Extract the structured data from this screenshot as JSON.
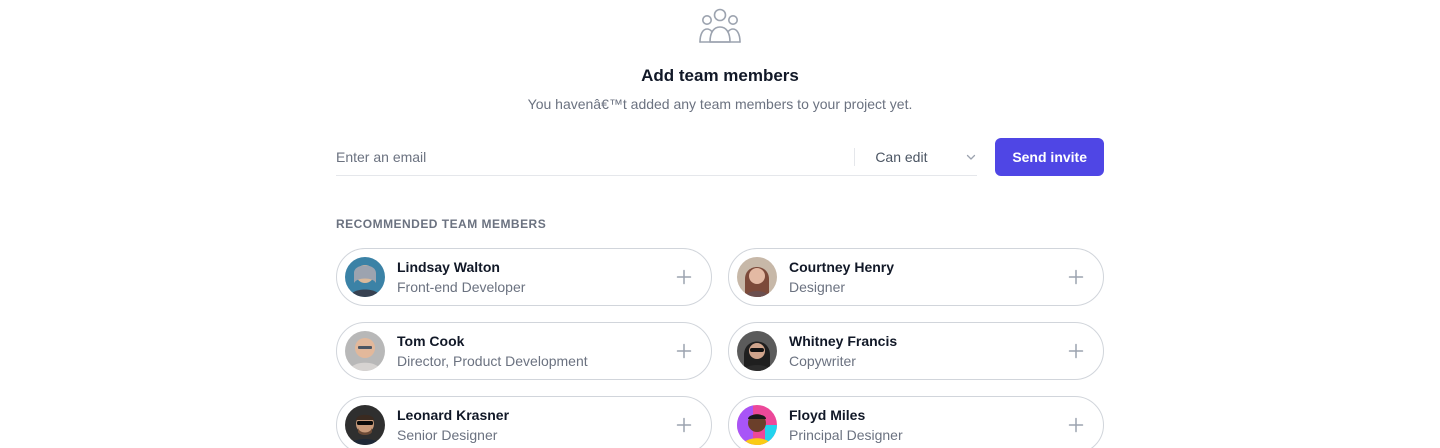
{
  "header": {
    "title": "Add team members",
    "subtitle": "You havenâ€™t added any team members to your project yet."
  },
  "invite": {
    "email_placeholder": "Enter an email",
    "permission": "Can edit",
    "send_label": "Send invite"
  },
  "recommended": {
    "heading": "RECOMMENDED TEAM MEMBERS",
    "members": [
      {
        "name": "Lindsay Walton",
        "role": "Front-end Developer"
      },
      {
        "name": "Courtney Henry",
        "role": "Designer"
      },
      {
        "name": "Tom Cook",
        "role": "Director, Product Development"
      },
      {
        "name": "Whitney Francis",
        "role": "Copywriter"
      },
      {
        "name": "Leonard Krasner",
        "role": "Senior Designer"
      },
      {
        "name": "Floyd Miles",
        "role": "Principal Designer"
      }
    ]
  },
  "icons": {
    "team": "user-group-icon",
    "chevron": "chevron-down-icon",
    "add": "plus-icon"
  },
  "colors": {
    "accent": "#4f46e5",
    "border": "#d1d5db",
    "muted_text": "#6b7280"
  }
}
